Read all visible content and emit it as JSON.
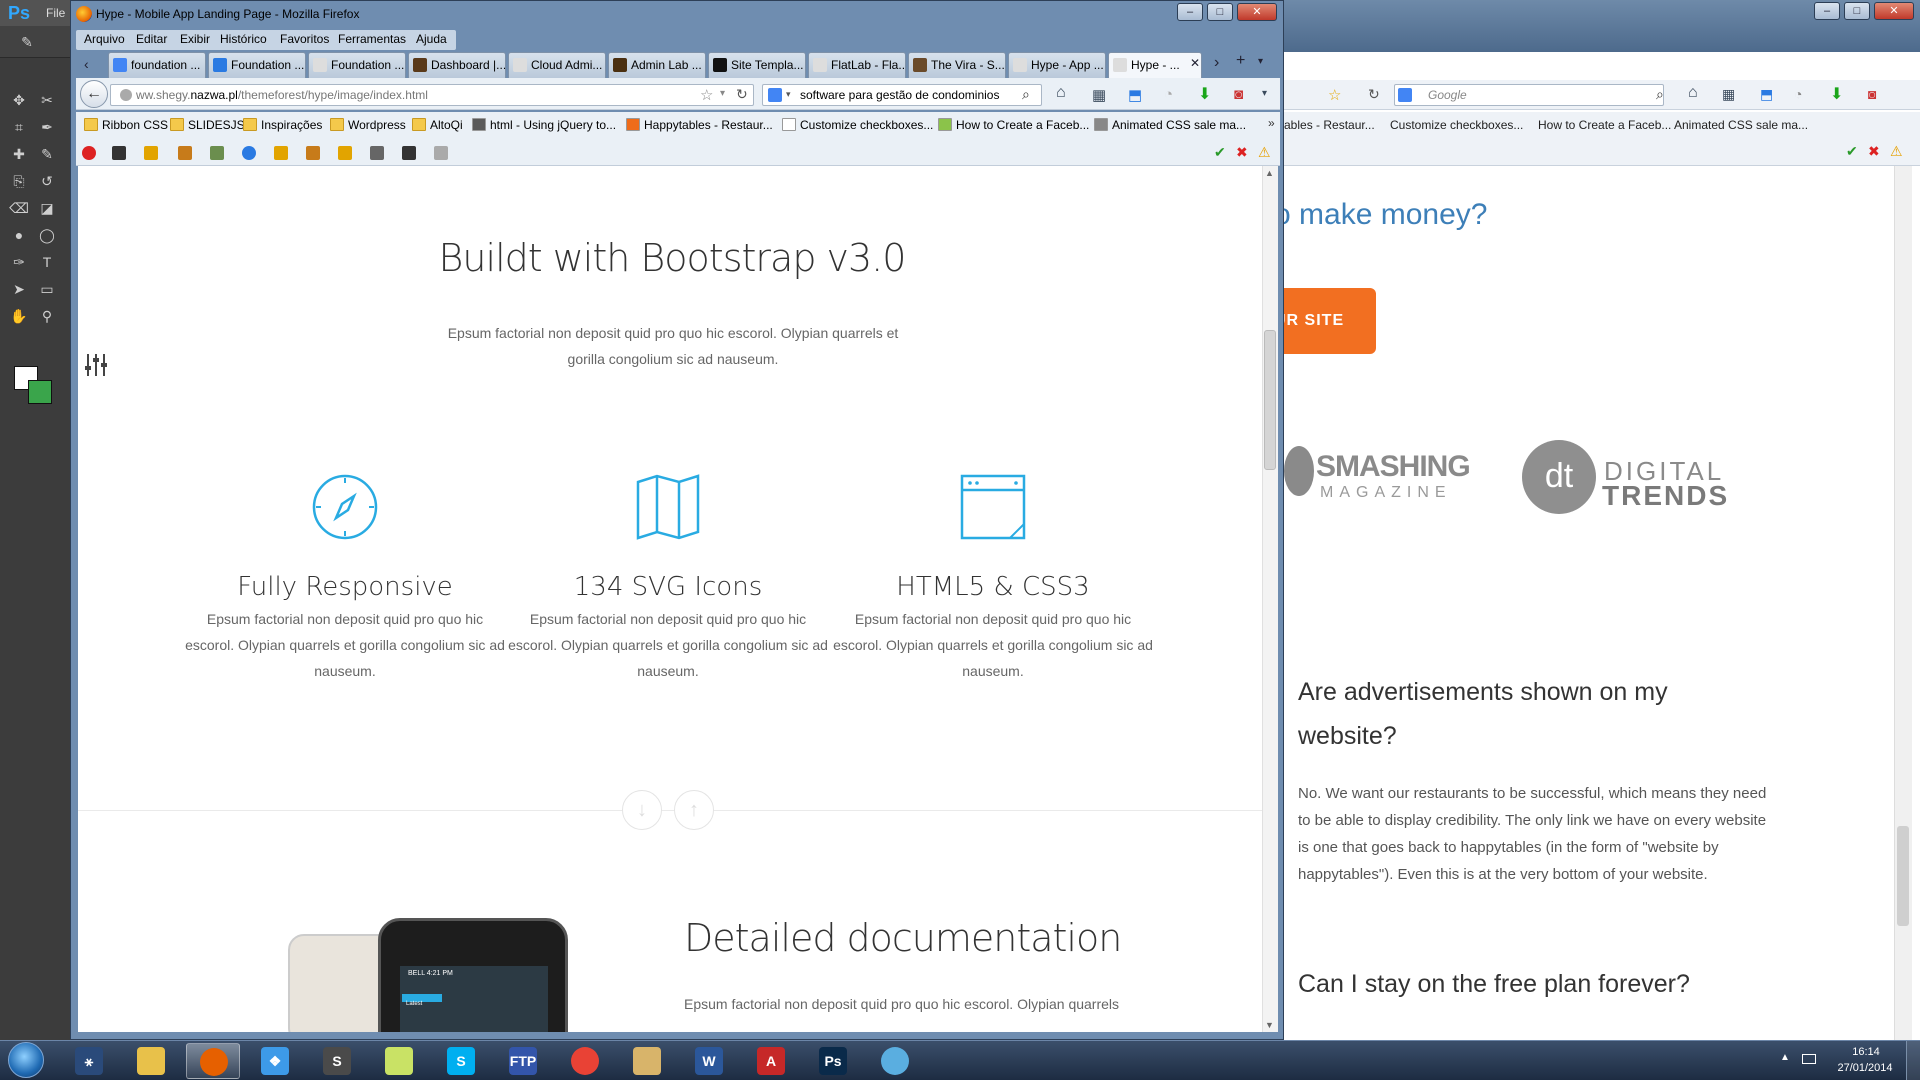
{
  "photoshop": {
    "logo": "Ps",
    "menu_file": "File",
    "tool_icons": [
      "move-tool-icon",
      "lasso-tool-icon",
      "crop-tool-icon",
      "eyedropper-tool-icon",
      "healing-tool-icon",
      "brush-tool-icon",
      "stamp-tool-icon",
      "history-brush-icon",
      "eraser-tool-icon",
      "paint-bucket-icon",
      "blur-tool-icon",
      "dodge-tool-icon",
      "pen-tool-icon",
      "type-tool-icon",
      "path-select-icon",
      "shape-tool-icon",
      "hand-tool-icon",
      "zoom-tool-icon"
    ],
    "foreground_color": "#ffffff",
    "background_color": "#3aa54b"
  },
  "window": {
    "title": "Hype - Mobile App Landing Page - Mozilla Firefox"
  },
  "menu": [
    "Arquivo",
    "Editar",
    "Exibir",
    "Histórico",
    "Favoritos",
    "Ferramentas",
    "Ajuda"
  ],
  "tabs": [
    {
      "label": "foundation ...",
      "color": "#4285f4"
    },
    {
      "label": "Foundation ...",
      "color": "#2a7ae2"
    },
    {
      "label": "Foundation ...",
      "color": "#dddddd"
    },
    {
      "label": "Dashboard |...",
      "color": "#5a3a1a"
    },
    {
      "label": "Cloud Admi...",
      "color": "#dddddd"
    },
    {
      "label": "Admin Lab ...",
      "color": "#4a2f10"
    },
    {
      "label": "Site Templa...",
      "color": "#111111"
    },
    {
      "label": "FlatLab - Fla...",
      "color": "#dddddd"
    },
    {
      "label": "The Vira - S...",
      "color": "#6a4a2a"
    },
    {
      "label": "Hype - App ...",
      "color": "#dddddd"
    },
    {
      "label": "Hype - ...",
      "color": "#dddddd",
      "active": true
    }
  ],
  "navbar": {
    "url_prefix": "ww.shegy.",
    "url_domain": "nazwa.pl",
    "url_path": "/themeforest/hype/image/index.html",
    "search_value": "software para gestão de condominios"
  },
  "bookmarks": [
    "Ribbon CSS",
    "SLIDESJS",
    "Inspirações",
    "Wordpress",
    "AltoQi",
    "html - Using jQuery to...",
    "Happytables - Restaur...",
    "Customize checkboxes...",
    "How to Create a Faceb...",
    "Animated CSS sale ma..."
  ],
  "page": {
    "title": "Buildt with Bootstrap v3.0",
    "description": "Epsum factorial non deposit quid pro quo hic escorol. Olypian quarrels et gorilla congolium sic ad nauseum.",
    "features": [
      {
        "icon": "compass-icon",
        "title": "Fully Responsive",
        "desc": "Epsum factorial non deposit quid pro quo hic escorol. Olypian quarrels et gorilla congolium sic ad nauseum."
      },
      {
        "icon": "map-icon",
        "title": "134 SVG Icons",
        "desc": "Epsum factorial non deposit quid pro quo hic escorol. Olypian quarrels et gorilla congolium sic ad nauseum."
      },
      {
        "icon": "browser-window-icon",
        "title": "HTML5 & CSS3",
        "desc": "Epsum factorial non deposit quid pro quo hic escorol. Olypian quarrels et gorilla congolium sic ad nauseum."
      }
    ],
    "accent_color": "#29abe2",
    "doc_title": "Detailed documentation",
    "doc_desc": "Epsum factorial non deposit quid pro quo hic escorol. Olypian quarrels",
    "phone_status": "BELL   4:21 PM",
    "phone_tab": "Latest"
  },
  "bg_window": {
    "search_placeholder": "Google",
    "bookmarks": [
      "ables - Restaur...",
      "Customize checkboxes...",
      "How to Create a Faceb...",
      "Animated CSS sale ma..."
    ],
    "heading": "o make money?",
    "cta": "UR SITE",
    "logo1_main": "SMASHING",
    "logo1_sub": "MAGAZINE",
    "logo2_mark": "dt",
    "logo2_line1": "DIGITAL",
    "logo2_line2": "TRENDS",
    "faq1_question": "Are advertisements shown on my website?",
    "faq1_answer": "No. We want our restaurants to be successful, which means they need to be able to display credibility. The only link we have on every website is one that goes back to happytables (in the form of \"website by happytables\"). Even this is at the very bottom of your website.",
    "faq2_question": "Can I stay on the free plan forever?"
  },
  "taskbar": {
    "apps": [
      {
        "name": "launchy",
        "color": "#2a4a7a",
        "glyph": "⚹"
      },
      {
        "name": "explorer",
        "color": "#e8c14a",
        "glyph": ""
      },
      {
        "name": "firefox",
        "color": "#e66000",
        "glyph": "",
        "active": true
      },
      {
        "name": "dropbox",
        "color": "#3d9ae8",
        "glyph": "❖"
      },
      {
        "name": "sublime",
        "color": "#4a4a4a",
        "glyph": "S"
      },
      {
        "name": "notes",
        "color": "#c9e265",
        "glyph": ""
      },
      {
        "name": "skype",
        "color": "#00aff0",
        "glyph": "S"
      },
      {
        "name": "ftp",
        "color": "#3355aa",
        "glyph": "FTP"
      },
      {
        "name": "chrome",
        "color": "#e94235",
        "glyph": ""
      },
      {
        "name": "folder",
        "color": "#d8b46a",
        "glyph": ""
      },
      {
        "name": "word",
        "color": "#2b579a",
        "glyph": "W"
      },
      {
        "name": "acrobat",
        "color": "#c62828",
        "glyph": "A"
      },
      {
        "name": "photoshop",
        "color": "#0a2a4a",
        "glyph": "Ps"
      },
      {
        "name": "finder",
        "color": "#5aaee0",
        "glyph": ""
      }
    ],
    "time": "16:14",
    "date": "27/01/2014"
  }
}
